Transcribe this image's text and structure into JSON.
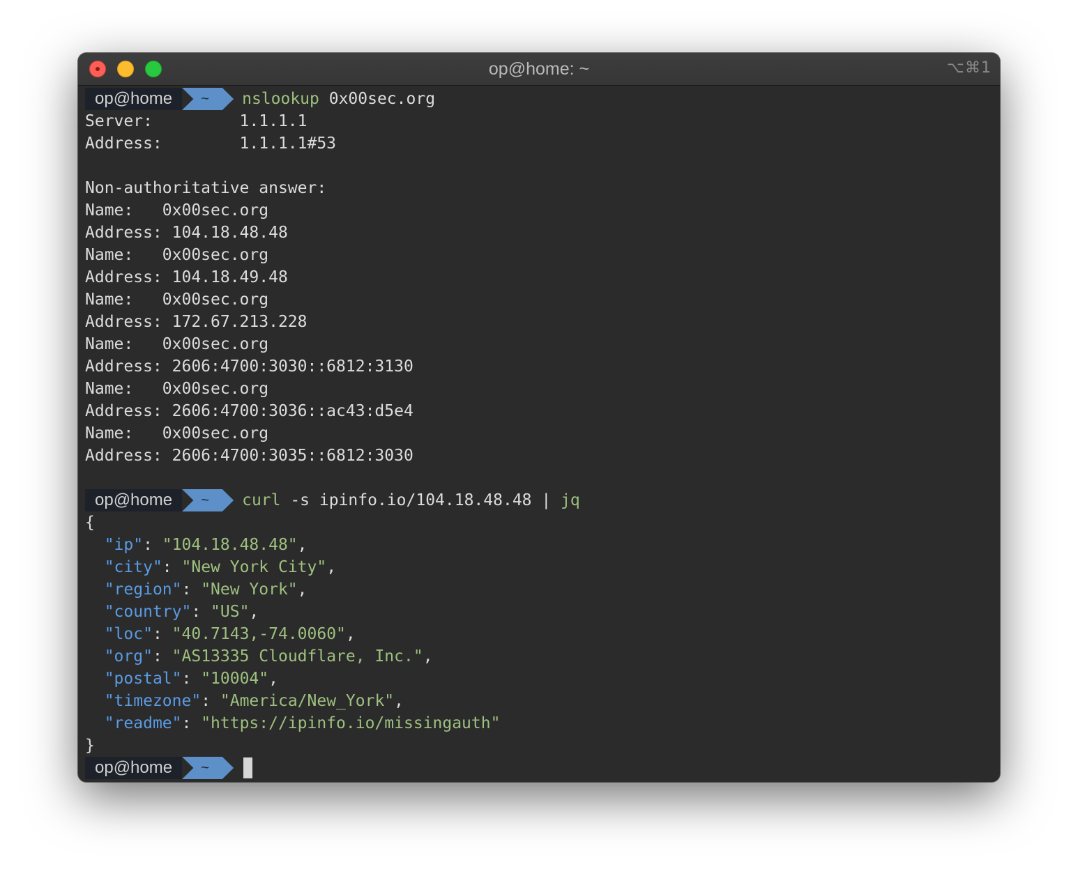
{
  "window": {
    "title": "op@home: ~",
    "shortcut": "⌥⌘1"
  },
  "prompt": {
    "user": "op@home",
    "dir": "~"
  },
  "commands": {
    "c1": {
      "prog": "nslookup",
      "args": " 0x00sec.org"
    },
    "c2": {
      "prog": "curl",
      "args": " -s ipinfo.io/104.18.48.48 | ",
      "pipe_prog": "jq"
    }
  },
  "nslookup_output": [
    "Server:\t\t1.1.1.1",
    "Address:\t1.1.1.1#53",
    "",
    "Non-authoritative answer:",
    "Name:\t0x00sec.org",
    "Address: 104.18.48.48",
    "Name:\t0x00sec.org",
    "Address: 104.18.49.48",
    "Name:\t0x00sec.org",
    "Address: 172.67.213.228",
    "Name:\t0x00sec.org",
    "Address: 2606:4700:3030::6812:3130",
    "Name:\t0x00sec.org",
    "Address: 2606:4700:3036::ac43:d5e4",
    "Name:\t0x00sec.org",
    "Address: 2606:4700:3035::6812:3030",
    ""
  ],
  "json_output": {
    "open": "{",
    "close": "}",
    "entries": [
      {
        "key": "\"ip\"",
        "value": "\"104.18.48.48\"",
        "comma": ","
      },
      {
        "key": "\"city\"",
        "value": "\"New York City\"",
        "comma": ","
      },
      {
        "key": "\"region\"",
        "value": "\"New York\"",
        "comma": ","
      },
      {
        "key": "\"country\"",
        "value": "\"US\"",
        "comma": ","
      },
      {
        "key": "\"loc\"",
        "value": "\"40.7143,-74.0060\"",
        "comma": ","
      },
      {
        "key": "\"org\"",
        "value": "\"AS13335 Cloudflare, Inc.\"",
        "comma": ","
      },
      {
        "key": "\"postal\"",
        "value": "\"10004\"",
        "comma": ","
      },
      {
        "key": "\"timezone\"",
        "value": "\"America/New_York\"",
        "comma": ","
      },
      {
        "key": "\"readme\"",
        "value": "\"https://ipinfo.io/missingauth\"",
        "comma": ""
      }
    ]
  },
  "colors": {
    "background": "#2b2b2b",
    "command_green": "#9ec07f",
    "json_key_blue": "#5a9be4",
    "prompt_dir_bg": "#5d8fc8"
  }
}
